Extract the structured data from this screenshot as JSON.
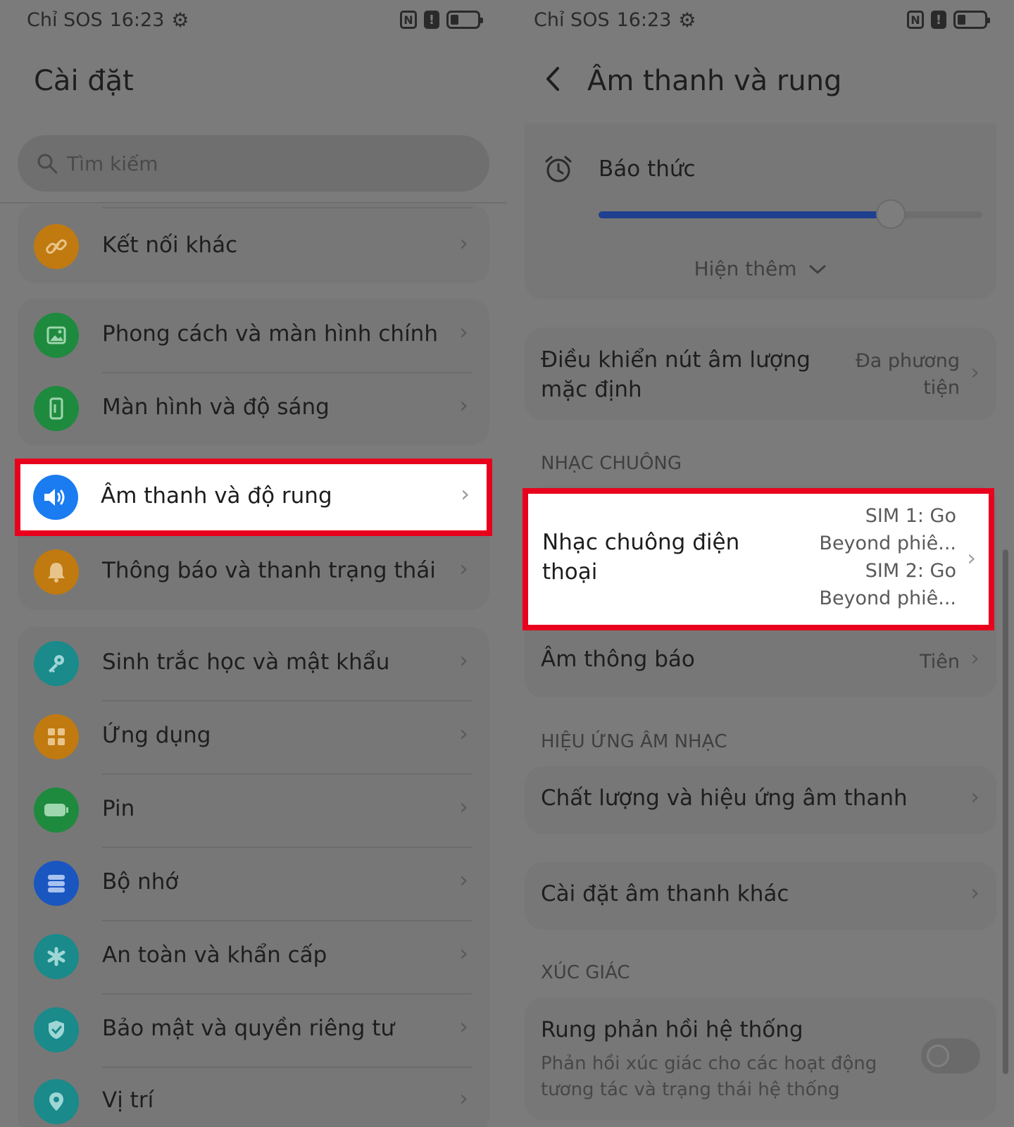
{
  "status_bar": {
    "carrier": "Chỉ SOS",
    "time": "16:23",
    "nfc": "N",
    "alert": "!",
    "battery_level": 0.3
  },
  "left": {
    "title": "Cài đặt",
    "search_placeholder": "Tìm kiếm",
    "items": [
      {
        "label": "Kết nối khác",
        "icon": "link-icon",
        "color": "#c07a10"
      },
      {
        "label": "Phong cách và màn hình chính",
        "icon": "image-icon",
        "color": "#1e8a3e"
      },
      {
        "label": "Màn hình và độ sáng",
        "icon": "phone-brightness-icon",
        "color": "#1e8a3e"
      },
      {
        "label": "Âm thanh và độ rung",
        "icon": "speaker-icon",
        "color": "#1a7cf0"
      },
      {
        "label": "Thông báo và thanh trạng thái",
        "icon": "bell-icon",
        "color": "#c07a10"
      },
      {
        "label": "Sinh trắc học và mật khẩu",
        "icon": "key-icon",
        "color": "#1a8a8a"
      },
      {
        "label": "Ứng dụng",
        "icon": "apps-grid-icon",
        "color": "#c07a10"
      },
      {
        "label": "Pin",
        "icon": "battery-icon",
        "color": "#1e8a3e"
      },
      {
        "label": "Bộ nhớ",
        "icon": "storage-icon",
        "color": "#1a56c0"
      },
      {
        "label": "An toàn và khẩn cấp",
        "icon": "asterisk-icon",
        "color": "#1a8a8a"
      },
      {
        "label": "Bảo mật và quyền riêng tư",
        "icon": "shield-icon",
        "color": "#1a8a8a"
      },
      {
        "label": "Vị trí",
        "icon": "location-pin-icon",
        "color": "#1a8a8a"
      }
    ]
  },
  "right": {
    "title": "Âm thanh và rung",
    "alarm": {
      "label": "Báo thức",
      "level": 0.8
    },
    "show_more": "Hiện thêm",
    "volume_control": {
      "label_line1": "Điều khiển nút âm lượng",
      "label_line2": "mặc định",
      "value_line1": "Đa phương",
      "value_line2": "tiện"
    },
    "section_ringtone": "NHẠC CHUÔNG",
    "ringtone": {
      "label_line1": "Nhạc chuông điện",
      "label_line2": "thoại",
      "sim1_line1": "SIM 1: Go",
      "sim1_line2": "Beyond phiê...",
      "sim2_line1": "SIM 2: Go",
      "sim2_line2": "Beyond phiê..."
    },
    "notification_sound": {
      "label": "Âm thông báo",
      "value": "Tiên"
    },
    "section_effects": "HIỆU ỨNG ÂM NHẠC",
    "quality": "Chất lượng và hiệu ứng âm thanh",
    "other_sound": "Cài đặt âm thanh khác",
    "section_haptics": "XÚC GIÁC",
    "haptic": {
      "label": "Rung phản hồi hệ thống",
      "desc_line1": "Phản hồi xúc giác cho các hoạt động",
      "desc_line2": "tương tác và trạng thái hệ thống",
      "enabled": false
    }
  }
}
